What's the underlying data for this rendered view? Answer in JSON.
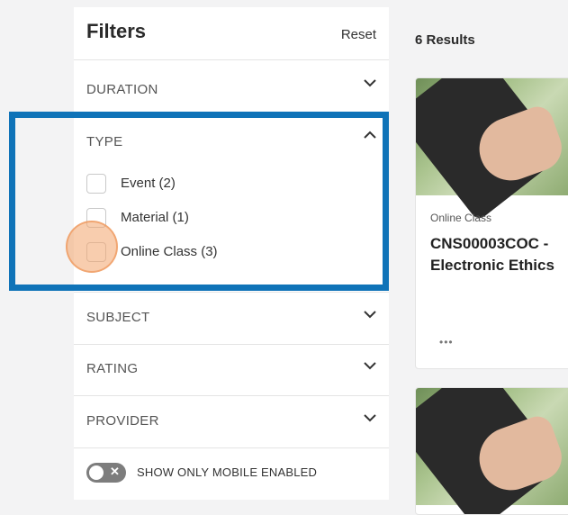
{
  "filters": {
    "title": "Filters",
    "reset_label": "Reset",
    "sections": {
      "duration": {
        "label": "DURATION",
        "expanded": false
      },
      "type": {
        "label": "TYPE",
        "expanded": true,
        "options": [
          {
            "label": "Event (2)",
            "checked": false
          },
          {
            "label": "Material (1)",
            "checked": false
          },
          {
            "label": "Online Class (3)",
            "checked": false
          }
        ]
      },
      "subject": {
        "label": "SUBJECT",
        "expanded": false
      },
      "rating": {
        "label": "RATING",
        "expanded": false
      },
      "provider": {
        "label": "PROVIDER",
        "expanded": false
      }
    },
    "mobile_toggle": {
      "label": "SHOW ONLY MOBILE ENABLED",
      "enabled": false,
      "icon": "x-icon"
    }
  },
  "results": {
    "count_label": "6 Results",
    "cards": [
      {
        "type": "Online Class",
        "title_line1": "CNS00003COC -",
        "title_line2": "Electronic Ethics",
        "more": "•••"
      },
      {
        "type": "",
        "title_line1": "",
        "title_line2": "",
        "more": ""
      }
    ]
  },
  "colors": {
    "highlight": "#0f73b8",
    "cursor": "#f2a46c",
    "toggle_off": "#7d7d7d"
  }
}
